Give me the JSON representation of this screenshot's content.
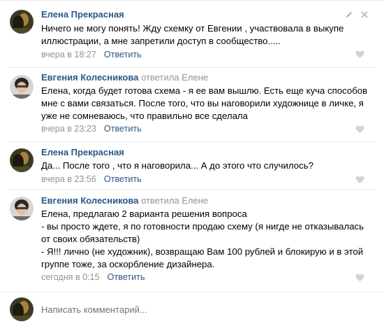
{
  "comments": [
    {
      "author": "Елена Прекрасная",
      "replied": "",
      "replied_to": "",
      "text": "Ничего не могу понять! Жду схемку от Евгении , участвовала в выкупе\nиллюстрации, а мне запретили доступ в сообщество.....",
      "time": "вчера в 18:27",
      "reply_label": "Ответить",
      "avatar": "elena-avatar",
      "like_icon": "heart-icon"
    },
    {
      "author": "Евгения Колесникова",
      "replied": "ответила",
      "replied_to": "Елене",
      "text": "Елена, когда будет готова схема - я ее вам вышлю. Есть еще куча способов\nмне с вами связаться. После того, что вы наговорили художнице в личке, я\nуже не сомневаюсь, что правильно все сделала",
      "time": "вчера в 23:23",
      "reply_label": "Ответить",
      "avatar": "evgenia-avatar",
      "like_icon": "heart-icon"
    },
    {
      "author": "Елена Прекрасная",
      "replied": "",
      "replied_to": "",
      "text": "Да... После того , что я наговорила... А до этого что случилось?",
      "time": "вчера в 23:56",
      "reply_label": "Ответить",
      "avatar": "elena-avatar",
      "like_icon": "heart-icon"
    },
    {
      "author": "Евгения Колесникова",
      "replied": "ответила",
      "replied_to": "Елене",
      "text": "Елена, предлагаю 2 варианта решения вопроса\n- вы просто ждете, я по готовности продаю схему (я нигде не отказывалась\nот своих обязательств)\n- Я!!! лично (не художник), возвращаю Вам 100 рублей и блокирую и в этой\nгруппе тоже, за оскорбление дизайнера.",
      "time": "сегодня в 0:15",
      "reply_label": "Ответить",
      "avatar": "evgenia-avatar",
      "like_icon": "heart-icon"
    }
  ],
  "composer": {
    "placeholder": "Написать комментарий..."
  },
  "toolbar": {
    "edit_icon": "pencil-icon",
    "close_icon": "close-icon"
  },
  "colors": {
    "link": "#2a5885",
    "muted": "#939393",
    "divider": "#e7e8ec"
  }
}
